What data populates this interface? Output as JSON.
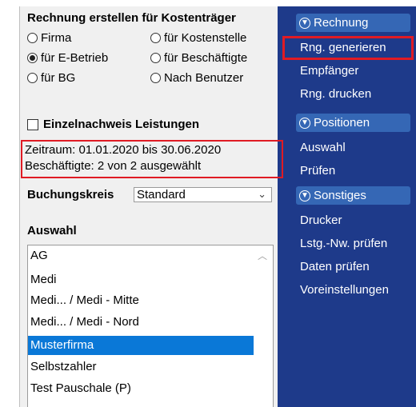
{
  "left": {
    "title": "Rechnung erstellen für Kostenträger",
    "radios": [
      {
        "label": "Firma",
        "checked": false
      },
      {
        "label": "für Kostenstelle",
        "checked": false
      },
      {
        "label": "für E-Betrieb",
        "checked": true
      },
      {
        "label": "für Beschäftigte",
        "checked": false
      },
      {
        "label": "für BG",
        "checked": false
      },
      {
        "label": "Nach Benutzer",
        "checked": false
      }
    ],
    "einzelnachweis_label": "Einzelnachweis Leistungen",
    "einzelnachweis_checked": false,
    "zeitraum": "Zeitraum: 01.01.2020 bis 30.06.2020",
    "beschaeftigte": "Beschäftigte: 2 von 2 ausgewählt",
    "buchungskreis_label": "Buchungskreis",
    "buchungskreis_value": "Standard",
    "auswahl_label": "Auswahl",
    "list": [
      "AG",
      "Medi",
      "Medi... / Medi - Mitte",
      "Medi... / Medi - Nord",
      "Musterfirma",
      "Selbstzahler",
      "Test Pauschale (P)"
    ],
    "selected_index": 4
  },
  "nav": {
    "rechnung": {
      "header": "Rechnung",
      "items": [
        "Rng. generieren",
        "Empfänger",
        "Rng. drucken"
      ]
    },
    "positionen": {
      "header": "Positionen",
      "items": [
        "Auswahl",
        "Prüfen"
      ]
    },
    "sonstiges": {
      "header": "Sonstiges",
      "items": [
        "Drucker",
        "Lstg.-Nw. prüfen",
        "Daten prüfen",
        "Voreinstellungen"
      ]
    }
  },
  "colors": {
    "nav_bg": "#1e3a8a",
    "nav_header": "#3567b5",
    "highlight": "#e01b24",
    "selection": "#0a78d7"
  },
  "icons": {
    "section_header": "circle-down-arrow-icon",
    "select": "chevron-down-icon",
    "scroll": "chevron-up-icon"
  }
}
